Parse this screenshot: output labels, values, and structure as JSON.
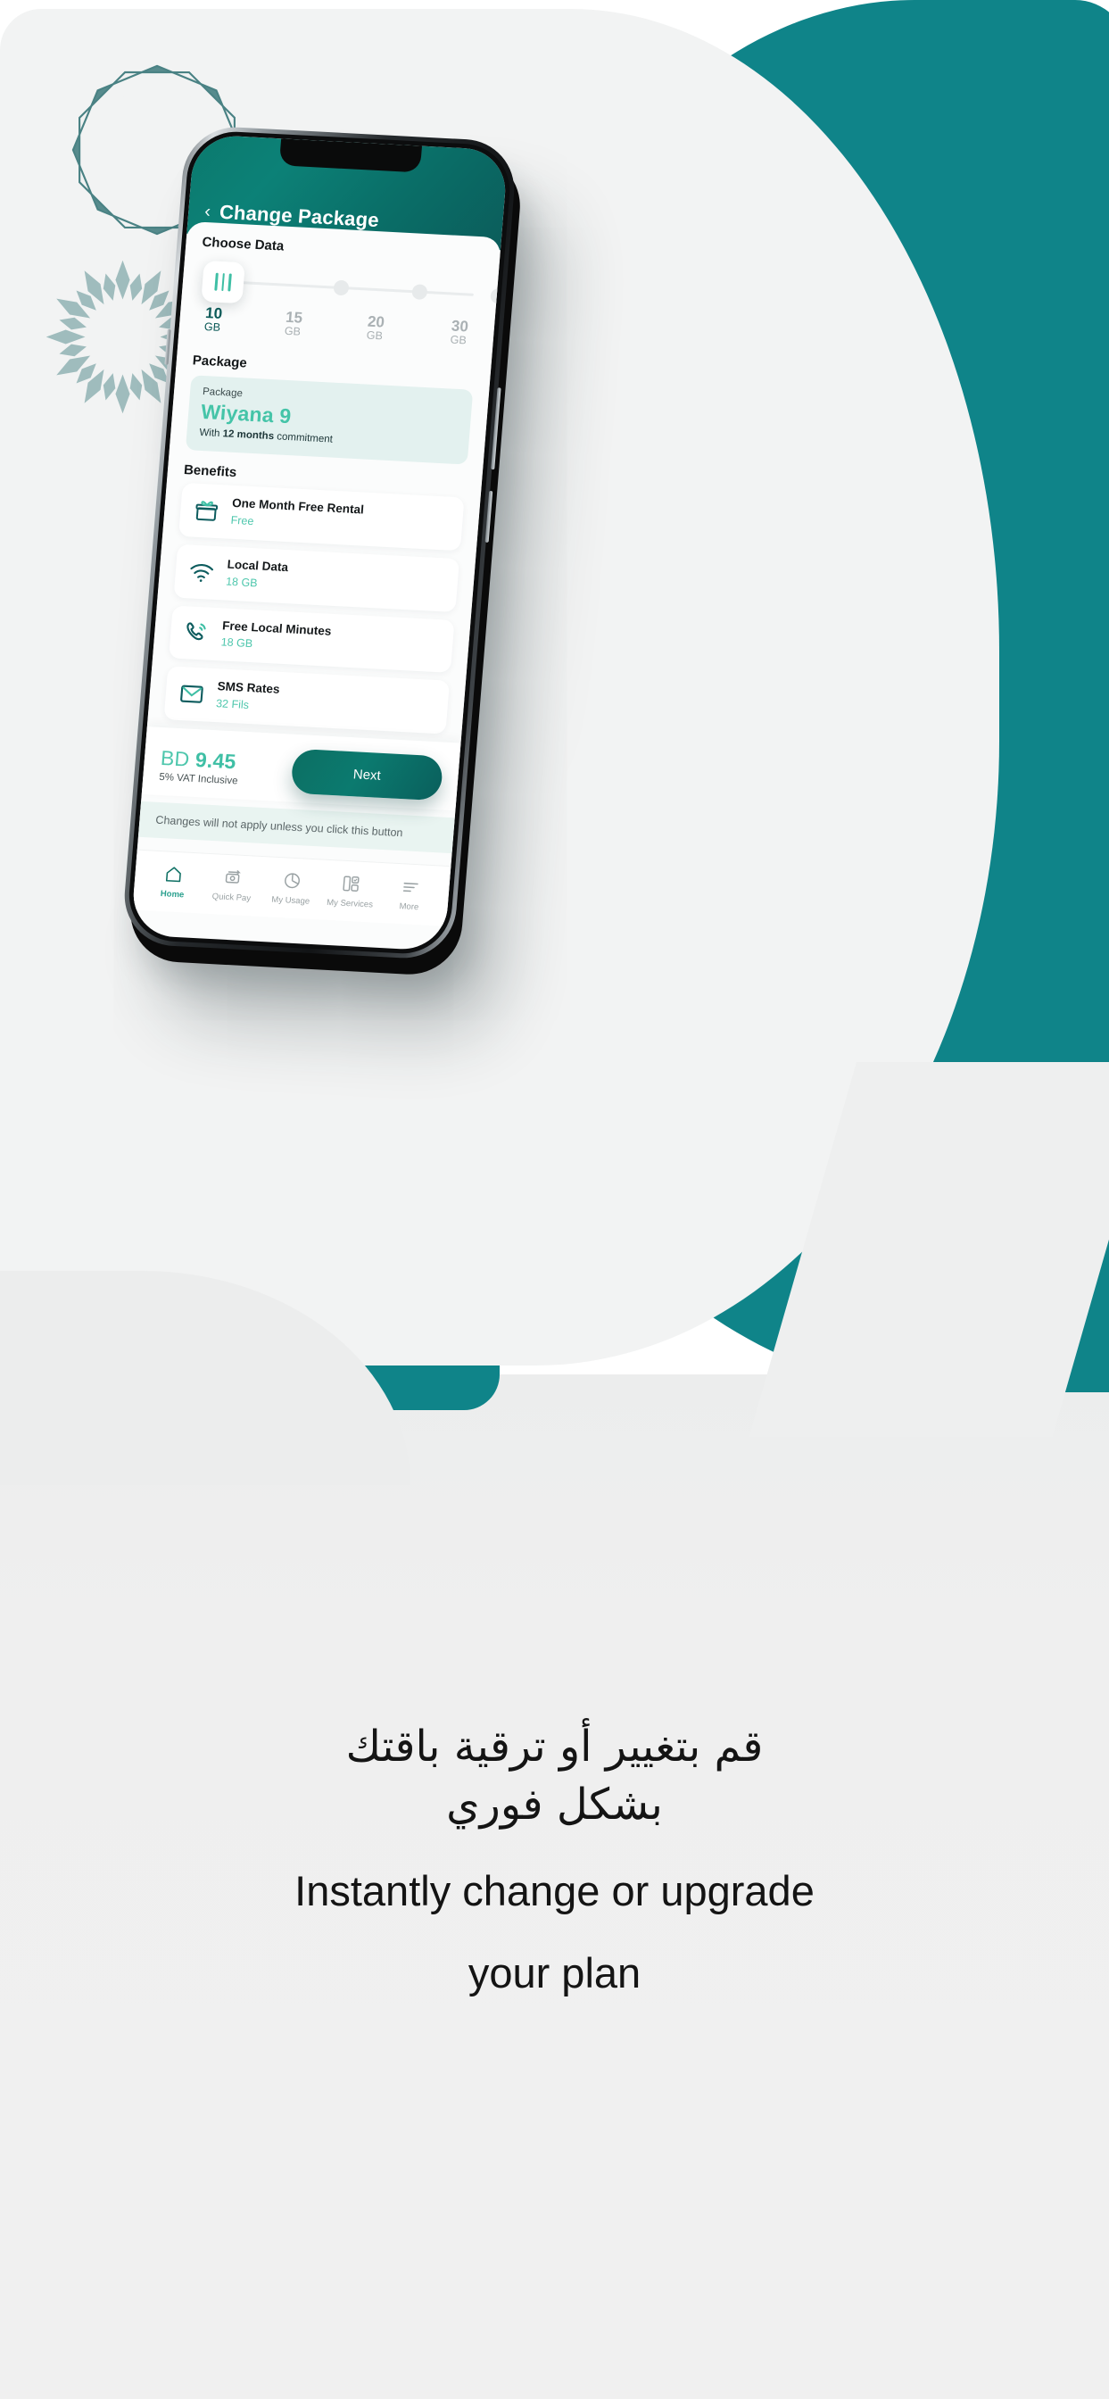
{
  "background": {
    "teal": "#0f8489",
    "panel": "#f2f3f3",
    "bottom": "#eeefef"
  },
  "ornaments": {
    "star_name": "decagram-star-ornament",
    "burst_name": "sunburst-ornament",
    "quad_name": "four-diamond-ornament",
    "star_color": "#3f7d80",
    "burst_color": "#9fbcbd",
    "quad_color": "#3f7d80"
  },
  "phone": {
    "app": {
      "header": {
        "back_icon": "chevron-left-icon",
        "back_glyph": "‹",
        "title": "Change Package"
      },
      "choose_data": {
        "section_title": "Choose Data",
        "thumb_icon": "bars-handle-icon",
        "selected_index": 0,
        "options": [
          {
            "value": "10",
            "unit": "GB"
          },
          {
            "value": "15",
            "unit": "GB"
          },
          {
            "value": "20",
            "unit": "GB"
          },
          {
            "value": "30",
            "unit": "GB"
          }
        ]
      },
      "package": {
        "section_title": "Package",
        "card_label": "Package",
        "name": "Wiyana 9",
        "commitment_prefix": "With ",
        "commitment_bold": "12 months",
        "commitment_suffix": " commitment"
      },
      "benefits": {
        "section_title": "Benefits",
        "items": [
          {
            "icon": "gift-icon",
            "title": "One Month Free Rental",
            "value": "Free"
          },
          {
            "icon": "wifi-icon",
            "title": "Local Data",
            "value": "18 GB"
          },
          {
            "icon": "phone-call-icon",
            "title": "Free Local Minutes",
            "value": "18 GB"
          },
          {
            "icon": "envelope-icon",
            "title": "SMS Rates",
            "value": "32 Fils"
          }
        ]
      },
      "footer": {
        "currency": "BD",
        "amount": "9.45",
        "vat_note": "5% VAT Inclusive",
        "next_label": "Next",
        "warning": "Changes will not apply unless you click this button"
      },
      "tabbar": {
        "items": [
          {
            "icon": "home-icon",
            "label": "Home",
            "active": true
          },
          {
            "icon": "quick-pay-icon",
            "label": "Quick Pay",
            "active": false
          },
          {
            "icon": "pie-chart-icon",
            "label": "My Usage",
            "active": false
          },
          {
            "icon": "services-grid-icon",
            "label": "My Services",
            "active": false
          },
          {
            "icon": "more-lines-icon",
            "label": "More",
            "active": false
          }
        ]
      }
    }
  },
  "caption": {
    "arabic_line1": "قم بتغيير أو ترقية باقتك",
    "arabic_line2": "بشكل فوري",
    "english_line1": "Instantly change or upgrade",
    "english_line2": "your plan"
  }
}
